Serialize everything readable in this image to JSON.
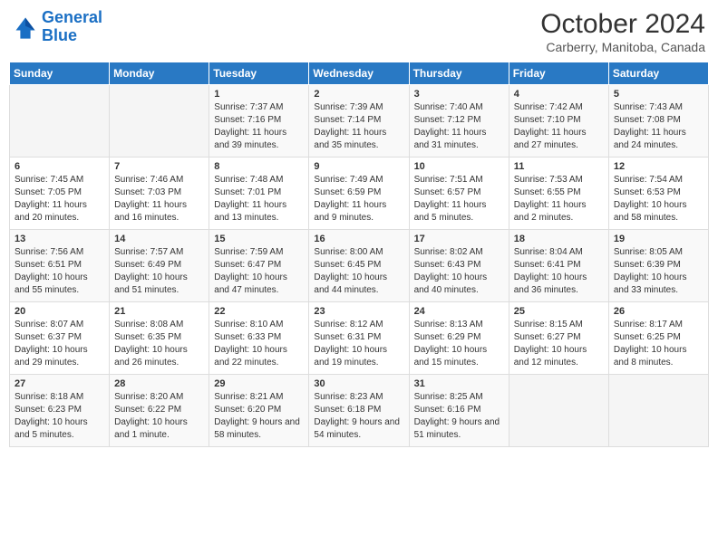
{
  "logo": {
    "line1": "General",
    "line2": "Blue"
  },
  "title": "October 2024",
  "location": "Carberry, Manitoba, Canada",
  "days_of_week": [
    "Sunday",
    "Monday",
    "Tuesday",
    "Wednesday",
    "Thursday",
    "Friday",
    "Saturday"
  ],
  "weeks": [
    [
      {
        "day": null
      },
      {
        "day": null
      },
      {
        "day": "1",
        "sunrise": "Sunrise: 7:37 AM",
        "sunset": "Sunset: 7:16 PM",
        "daylight": "Daylight: 11 hours and 39 minutes."
      },
      {
        "day": "2",
        "sunrise": "Sunrise: 7:39 AM",
        "sunset": "Sunset: 7:14 PM",
        "daylight": "Daylight: 11 hours and 35 minutes."
      },
      {
        "day": "3",
        "sunrise": "Sunrise: 7:40 AM",
        "sunset": "Sunset: 7:12 PM",
        "daylight": "Daylight: 11 hours and 31 minutes."
      },
      {
        "day": "4",
        "sunrise": "Sunrise: 7:42 AM",
        "sunset": "Sunset: 7:10 PM",
        "daylight": "Daylight: 11 hours and 27 minutes."
      },
      {
        "day": "5",
        "sunrise": "Sunrise: 7:43 AM",
        "sunset": "Sunset: 7:08 PM",
        "daylight": "Daylight: 11 hours and 24 minutes."
      }
    ],
    [
      {
        "day": "6",
        "sunrise": "Sunrise: 7:45 AM",
        "sunset": "Sunset: 7:05 PM",
        "daylight": "Daylight: 11 hours and 20 minutes."
      },
      {
        "day": "7",
        "sunrise": "Sunrise: 7:46 AM",
        "sunset": "Sunset: 7:03 PM",
        "daylight": "Daylight: 11 hours and 16 minutes."
      },
      {
        "day": "8",
        "sunrise": "Sunrise: 7:48 AM",
        "sunset": "Sunset: 7:01 PM",
        "daylight": "Daylight: 11 hours and 13 minutes."
      },
      {
        "day": "9",
        "sunrise": "Sunrise: 7:49 AM",
        "sunset": "Sunset: 6:59 PM",
        "daylight": "Daylight: 11 hours and 9 minutes."
      },
      {
        "day": "10",
        "sunrise": "Sunrise: 7:51 AM",
        "sunset": "Sunset: 6:57 PM",
        "daylight": "Daylight: 11 hours and 5 minutes."
      },
      {
        "day": "11",
        "sunrise": "Sunrise: 7:53 AM",
        "sunset": "Sunset: 6:55 PM",
        "daylight": "Daylight: 11 hours and 2 minutes."
      },
      {
        "day": "12",
        "sunrise": "Sunrise: 7:54 AM",
        "sunset": "Sunset: 6:53 PM",
        "daylight": "Daylight: 10 hours and 58 minutes."
      }
    ],
    [
      {
        "day": "13",
        "sunrise": "Sunrise: 7:56 AM",
        "sunset": "Sunset: 6:51 PM",
        "daylight": "Daylight: 10 hours and 55 minutes."
      },
      {
        "day": "14",
        "sunrise": "Sunrise: 7:57 AM",
        "sunset": "Sunset: 6:49 PM",
        "daylight": "Daylight: 10 hours and 51 minutes."
      },
      {
        "day": "15",
        "sunrise": "Sunrise: 7:59 AM",
        "sunset": "Sunset: 6:47 PM",
        "daylight": "Daylight: 10 hours and 47 minutes."
      },
      {
        "day": "16",
        "sunrise": "Sunrise: 8:00 AM",
        "sunset": "Sunset: 6:45 PM",
        "daylight": "Daylight: 10 hours and 44 minutes."
      },
      {
        "day": "17",
        "sunrise": "Sunrise: 8:02 AM",
        "sunset": "Sunset: 6:43 PM",
        "daylight": "Daylight: 10 hours and 40 minutes."
      },
      {
        "day": "18",
        "sunrise": "Sunrise: 8:04 AM",
        "sunset": "Sunset: 6:41 PM",
        "daylight": "Daylight: 10 hours and 36 minutes."
      },
      {
        "day": "19",
        "sunrise": "Sunrise: 8:05 AM",
        "sunset": "Sunset: 6:39 PM",
        "daylight": "Daylight: 10 hours and 33 minutes."
      }
    ],
    [
      {
        "day": "20",
        "sunrise": "Sunrise: 8:07 AM",
        "sunset": "Sunset: 6:37 PM",
        "daylight": "Daylight: 10 hours and 29 minutes."
      },
      {
        "day": "21",
        "sunrise": "Sunrise: 8:08 AM",
        "sunset": "Sunset: 6:35 PM",
        "daylight": "Daylight: 10 hours and 26 minutes."
      },
      {
        "day": "22",
        "sunrise": "Sunrise: 8:10 AM",
        "sunset": "Sunset: 6:33 PM",
        "daylight": "Daylight: 10 hours and 22 minutes."
      },
      {
        "day": "23",
        "sunrise": "Sunrise: 8:12 AM",
        "sunset": "Sunset: 6:31 PM",
        "daylight": "Daylight: 10 hours and 19 minutes."
      },
      {
        "day": "24",
        "sunrise": "Sunrise: 8:13 AM",
        "sunset": "Sunset: 6:29 PM",
        "daylight": "Daylight: 10 hours and 15 minutes."
      },
      {
        "day": "25",
        "sunrise": "Sunrise: 8:15 AM",
        "sunset": "Sunset: 6:27 PM",
        "daylight": "Daylight: 10 hours and 12 minutes."
      },
      {
        "day": "26",
        "sunrise": "Sunrise: 8:17 AM",
        "sunset": "Sunset: 6:25 PM",
        "daylight": "Daylight: 10 hours and 8 minutes."
      }
    ],
    [
      {
        "day": "27",
        "sunrise": "Sunrise: 8:18 AM",
        "sunset": "Sunset: 6:23 PM",
        "daylight": "Daylight: 10 hours and 5 minutes."
      },
      {
        "day": "28",
        "sunrise": "Sunrise: 8:20 AM",
        "sunset": "Sunset: 6:22 PM",
        "daylight": "Daylight: 10 hours and 1 minute."
      },
      {
        "day": "29",
        "sunrise": "Sunrise: 8:21 AM",
        "sunset": "Sunset: 6:20 PM",
        "daylight": "Daylight: 9 hours and 58 minutes."
      },
      {
        "day": "30",
        "sunrise": "Sunrise: 8:23 AM",
        "sunset": "Sunset: 6:18 PM",
        "daylight": "Daylight: 9 hours and 54 minutes."
      },
      {
        "day": "31",
        "sunrise": "Sunrise: 8:25 AM",
        "sunset": "Sunset: 6:16 PM",
        "daylight": "Daylight: 9 hours and 51 minutes."
      },
      {
        "day": null
      },
      {
        "day": null
      }
    ]
  ]
}
